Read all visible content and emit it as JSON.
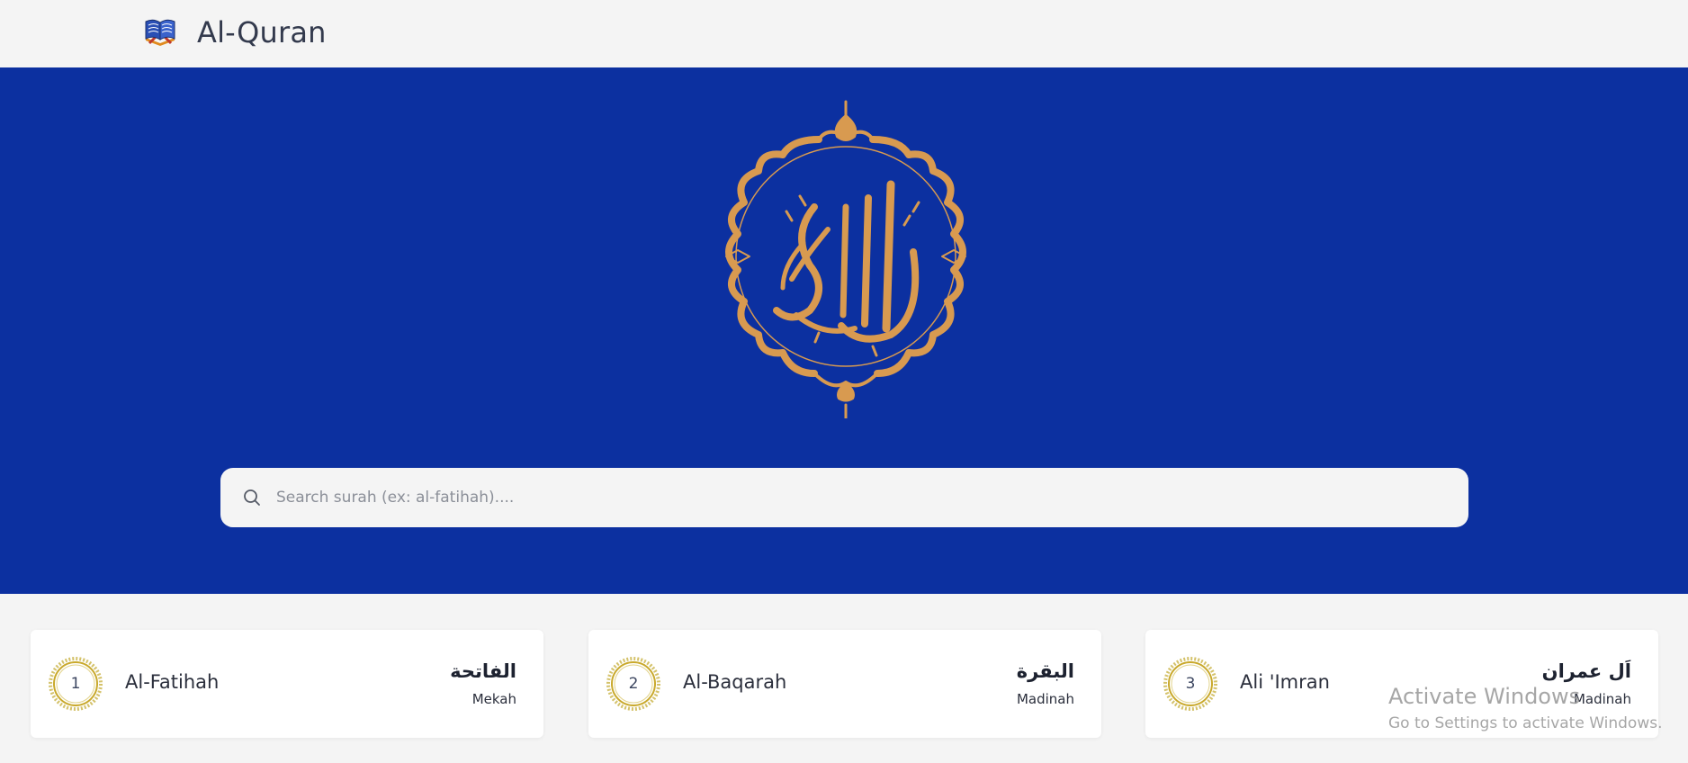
{
  "app": {
    "title": "Al-Quran",
    "logo_icon": "open-quran-book-icon"
  },
  "hero": {
    "emblem": "al-quran-al-karim-calligraphy-emblem",
    "background_color": "#0c30a0",
    "accent_color": "#d89a50"
  },
  "search": {
    "icon": "search-icon",
    "placeholder": "Search surah (ex: al-fatihah)....",
    "value": ""
  },
  "surahs": [
    {
      "number": "1",
      "name": "Al-Fatihah",
      "arabic": "الفاتحة",
      "place": "Mekah"
    },
    {
      "number": "2",
      "name": "Al-Baqarah",
      "arabic": "البقرة",
      "place": "Madinah"
    },
    {
      "number": "3",
      "name": "Ali 'Imran",
      "arabic": "اَل عمران",
      "place": "Madinah"
    }
  ],
  "watermark": {
    "title": "Activate Windows",
    "subtitle": "Go to Settings to activate Windows."
  }
}
